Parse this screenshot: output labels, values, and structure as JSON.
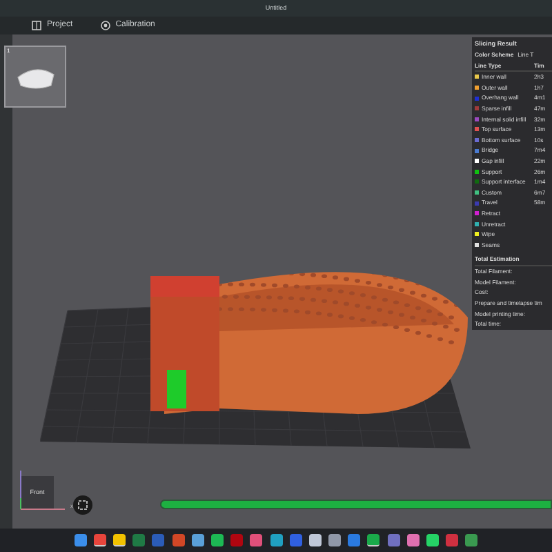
{
  "window": {
    "title": "Untitled"
  },
  "tabs": [
    {
      "label": "Project",
      "selected": false
    },
    {
      "label": "Calibration",
      "selected": false
    }
  ],
  "slicing_result": {
    "title": "Slicing Result",
    "color_scheme_label": "Color Scheme",
    "color_scheme_value": "Line T",
    "columns": [
      "Line Type",
      "Tim"
    ],
    "line_types": [
      {
        "name": "Inner wall",
        "color": "#e8c74a",
        "time": "2h3"
      },
      {
        "name": "Outer wall",
        "color": "#f0a030",
        "time": "1h7"
      },
      {
        "name": "Overhang wall",
        "color": "#1f2fd0",
        "time": "4m1"
      },
      {
        "name": "Sparse infill",
        "color": "#a03a3a",
        "time": "47m"
      },
      {
        "name": "Internal solid infill",
        "color": "#9a4ac0",
        "time": "32m"
      },
      {
        "name": "Top surface",
        "color": "#e05050",
        "time": "13m"
      },
      {
        "name": "Bottom surface",
        "color": "#6a6ad0",
        "time": "10s"
      },
      {
        "name": "Bridge",
        "color": "#4a7ad0",
        "time": "7m4"
      },
      {
        "name": "Gap infill",
        "color": "#ffffff",
        "time": "22m"
      },
      {
        "name": "Support",
        "color": "#10c010",
        "time": "26m"
      },
      {
        "name": "Support interface",
        "color": "#106a10",
        "time": "1m4"
      },
      {
        "name": "Custom",
        "color": "#40c080",
        "time": "6m7"
      },
      {
        "name": "Travel",
        "color": "#3a3ab0",
        "time": "58m"
      },
      {
        "name": "Retract",
        "color": "#d020d0"
      },
      {
        "name": "Unretract",
        "color": "#30b0b0"
      },
      {
        "name": "Wipe",
        "color": "#f0f020"
      },
      {
        "name": "Seams",
        "color": "#e0e0e0"
      }
    ],
    "total_title": "Total Estimation",
    "totals": [
      "Total Filament:",
      "Model Filament:",
      "Cost:",
      "Prepare and timelapse tim",
      "Model printing time:",
      "Total time:"
    ]
  },
  "plate": {
    "number": "1"
  },
  "view_cube": {
    "label": "Front",
    "axis": "x"
  },
  "progress": {
    "level": 1
  },
  "taskbar": {
    "apps": [
      {
        "color": "#3b8eea",
        "active": false
      },
      {
        "color": "#e8453c",
        "active": true
      },
      {
        "color": "#f2c200",
        "active": true
      },
      {
        "color": "#1f7a45",
        "active": false
      },
      {
        "color": "#2b5cb8",
        "active": false
      },
      {
        "color": "#d24726",
        "active": false
      },
      {
        "color": "#5aa0d8",
        "active": false
      },
      {
        "color": "#1db954",
        "active": false
      },
      {
        "color": "#b00610",
        "active": false
      },
      {
        "color": "#e0507a",
        "active": false
      },
      {
        "color": "#20a0c0",
        "active": false
      },
      {
        "color": "#3060e0",
        "active": false
      },
      {
        "color": "#c0c8d8",
        "active": false
      },
      {
        "color": "#9098a8",
        "active": false
      },
      {
        "color": "#2a7ae0",
        "active": false
      },
      {
        "color": "#1aaa4a",
        "active": true
      },
      {
        "color": "#7070c0",
        "active": false
      },
      {
        "color": "#e070b0",
        "active": false
      },
      {
        "color": "#25d366",
        "active": false
      },
      {
        "color": "#d03040",
        "active": false
      },
      {
        "color": "#3a9a50",
        "active": false
      }
    ]
  }
}
